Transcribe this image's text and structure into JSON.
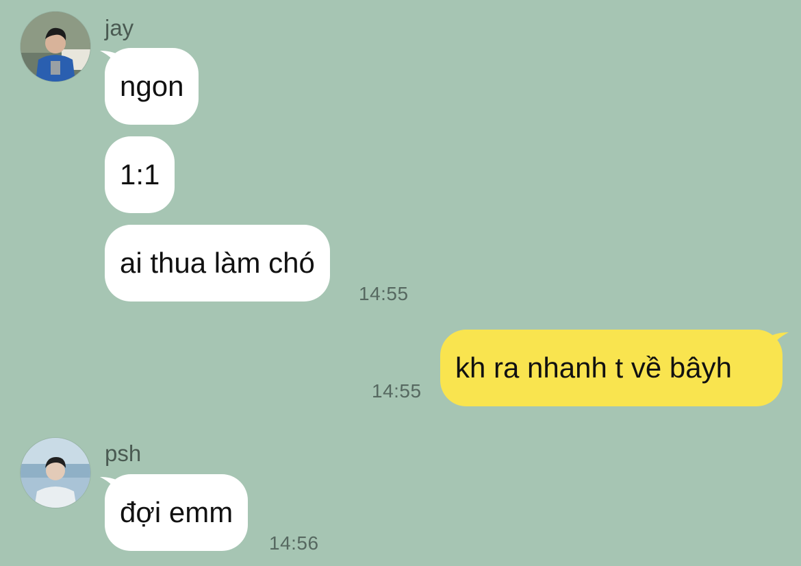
{
  "colors": {
    "background": "#a6c5b3",
    "incoming_bubble": "#ffffff",
    "outgoing_bubble": "#f9e44f",
    "timestamp": "#566860",
    "sender_name": "#4a5a52"
  },
  "groups": [
    {
      "sender": "jay",
      "avatar_icon": "user-avatar-photo",
      "messages": [
        {
          "text": "ngon"
        },
        {
          "text": "1:1"
        },
        {
          "text": "ai thua làm chó",
          "time": "14:55"
        }
      ]
    },
    {
      "sender": "me",
      "messages": [
        {
          "text": "kh ra nhanh t về bâyh",
          "time": "14:55"
        }
      ]
    },
    {
      "sender": "psh",
      "avatar_icon": "user-avatar-photo",
      "messages": [
        {
          "text": "đợi emm",
          "time": "14:56"
        }
      ]
    }
  ]
}
